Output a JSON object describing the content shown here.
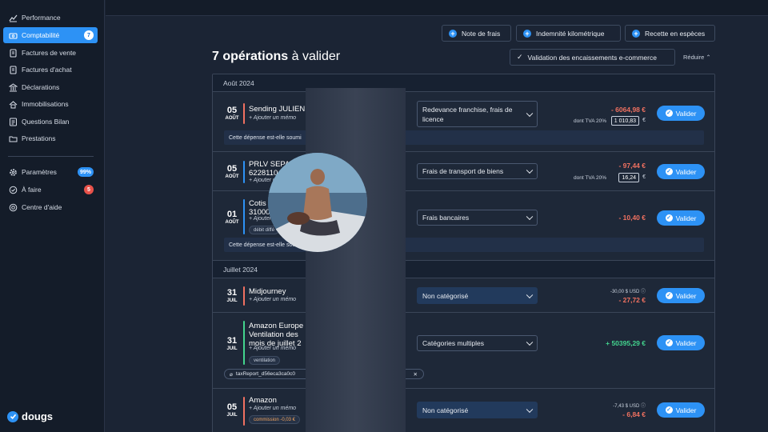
{
  "sidebar": {
    "items": [
      {
        "label": "Performance",
        "icon": "chart-line-icon"
      },
      {
        "label": "Comptabilité",
        "icon": "money-icon",
        "badge": "7",
        "active": true
      },
      {
        "label": "Factures de vente",
        "icon": "document-icon"
      },
      {
        "label": "Factures d'achat",
        "icon": "document-icon"
      },
      {
        "label": "Déclarations",
        "icon": "bank-icon"
      },
      {
        "label": "Immobilisations",
        "icon": "home-icon"
      },
      {
        "label": "Questions Bilan",
        "icon": "list-icon"
      },
      {
        "label": "Prestations",
        "icon": "folder-icon"
      }
    ],
    "bottom_items": [
      {
        "label": "Paramètres",
        "icon": "gear-icon",
        "badge": "99%"
      },
      {
        "label": "À faire",
        "icon": "check-circle-icon",
        "badge": "5"
      },
      {
        "label": "Centre d'aide",
        "icon": "help-icon"
      }
    ],
    "logo": "dougs"
  },
  "actions": {
    "note_de_frais": "Note de frais",
    "indemnite": "Indemnité kilométrique",
    "recette": "Recette en espèces",
    "validation": "Validation des encaissements e-commerce",
    "reduire": "Réduire"
  },
  "heading": {
    "count": "7 opérations",
    "rest": "à valider"
  },
  "months": {
    "aout": "Août 2024",
    "juillet": "Juillet 2024"
  },
  "common": {
    "memo": "+ Ajouter un mémo",
    "valider": "Valider",
    "tva": "dont TVA 20%",
    "euro": "€"
  },
  "operations": [
    {
      "day": "05",
      "month": "AOÛT",
      "name": "Sending JULIEN",
      "category": "Redevance franchise, frais de licence",
      "amount": "- 6064,98 €",
      "tva": "1 010,83",
      "question": "Cette dépense est-elle soumi"
    },
    {
      "day": "05",
      "month": "AOÛT",
      "name_line1": "PRLV SEPA",
      "name_line2": "6228110",
      "category": "Frais de transport de biens",
      "amount": "- 97,44 €",
      "tva": "16,24"
    },
    {
      "day": "01",
      "month": "AOÛT",
      "name_line1": "Cotis",
      "name_line2": "31000",
      "tag": "débit diffé",
      "category": "Frais bancaires",
      "amount": "- 10,40 €",
      "question": "Cette dépense est-elle sou"
    },
    {
      "day": "31",
      "month": "JUIL",
      "name": "Midjourney",
      "category": "Non catégorisé",
      "usd": "-30,00 $ USD",
      "amount": "- 27,72 €"
    },
    {
      "day": "31",
      "month": "JUIL",
      "name_line1": "Amazon Europe",
      "name_line2": "Ventilation des",
      "name_line3": "mois de juillet 2",
      "tag": "ventilation",
      "category": "Catégories multiples",
      "amount": "+ 50395,29 €",
      "attachment": "taxReport_d56eca3ca0c0"
    },
    {
      "day": "05",
      "month": "JUIL",
      "name": "Amazon",
      "tag": "commission -0,03 €",
      "category": "Non catégorisé",
      "usd": "-7,43 $ USD",
      "amount": "- 6,84 €"
    }
  ],
  "colors": {
    "accent": "#2d92f5",
    "negative": "#f07160",
    "positive": "#43d48e",
    "background": "#1b2434"
  }
}
